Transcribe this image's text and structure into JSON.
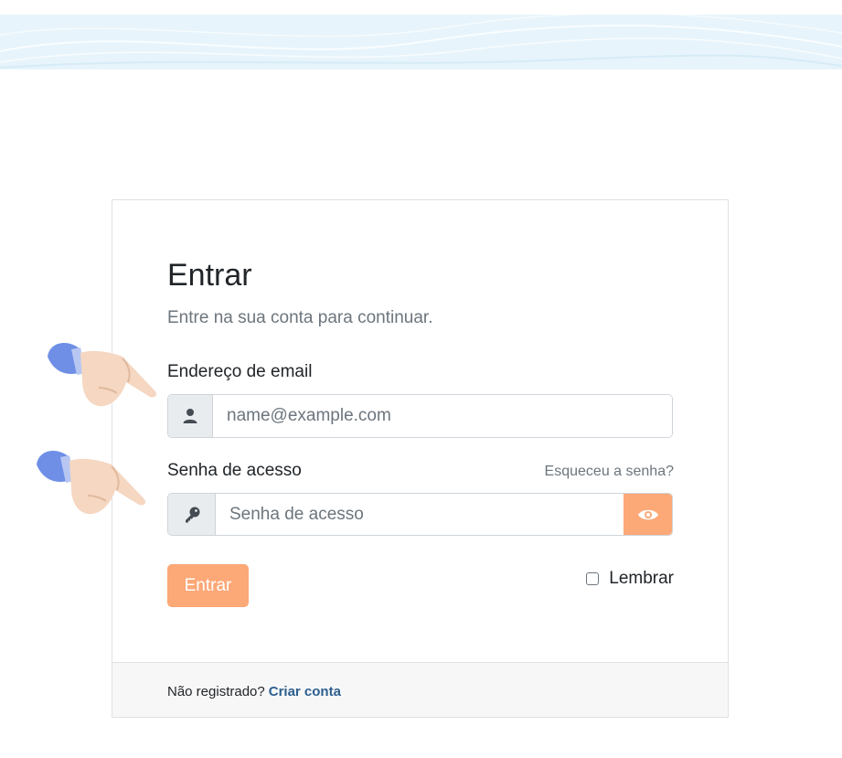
{
  "login": {
    "title": "Entrar",
    "subtitle": "Entre na sua conta para continuar.",
    "email_label": "Endereço de email",
    "email_placeholder": "name@example.com",
    "password_label": "Senha de acesso",
    "password_placeholder": "Senha de acesso",
    "forgot_link": "Esqueceu a senha?",
    "submit_label": "Entrar",
    "remember_label": "Lembrar",
    "remember_checked": false
  },
  "footer": {
    "prompt": "Não registrado?",
    "signup_link": "Criar conta"
  },
  "icons": {
    "email_addon": "user-icon",
    "password_addon": "key-icon",
    "toggle_password": "eye-icon",
    "pointer": "pointing-hand-icon"
  },
  "colors": {
    "accent": "#fda877",
    "link": "#2c5e8f",
    "muted": "#6c757d",
    "addon_bg": "#e9ecef",
    "footer_bg": "#f7f7f7",
    "banner": "#e7f4fb"
  }
}
